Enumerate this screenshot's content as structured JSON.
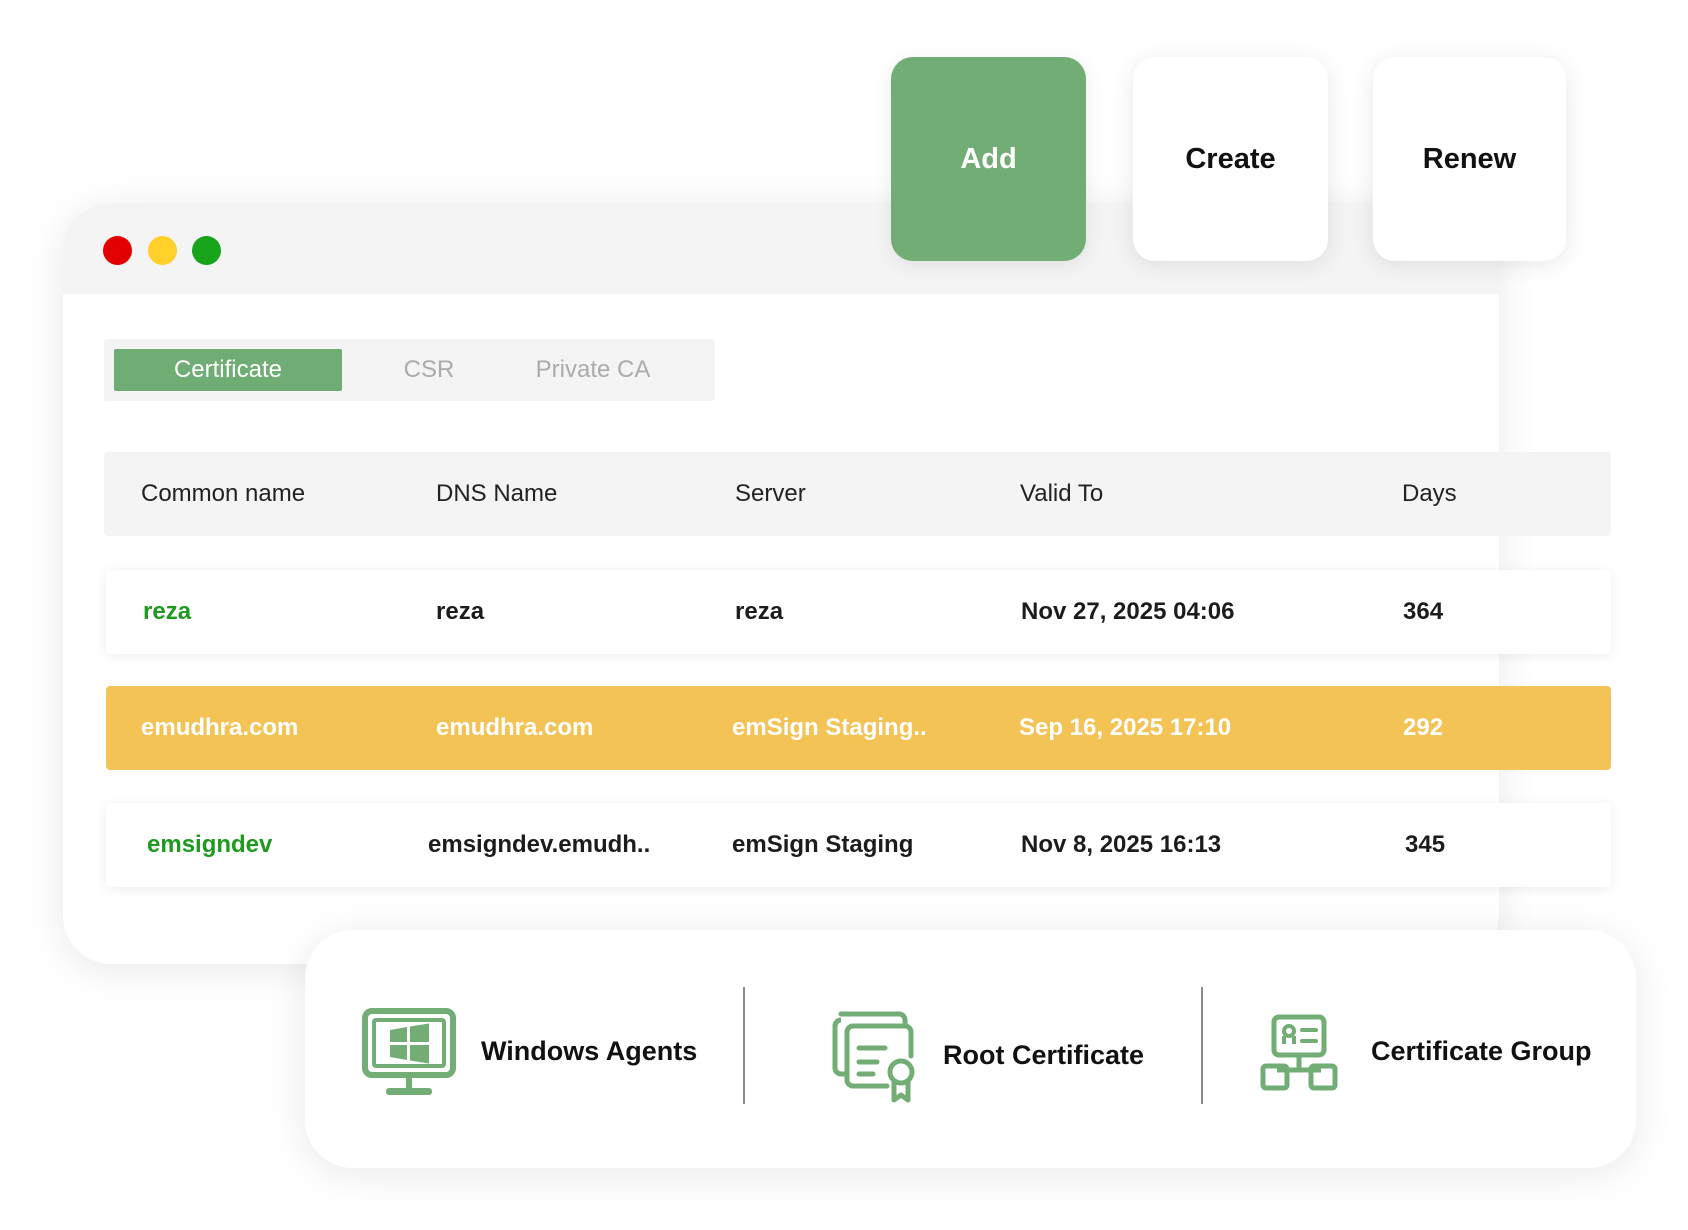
{
  "window": {
    "controls": [
      "close",
      "minimize",
      "maximize"
    ]
  },
  "tabs": [
    {
      "label": "Certificate",
      "active": true
    },
    {
      "label": "CSR",
      "active": false
    },
    {
      "label": "Private CA",
      "active": false
    }
  ],
  "table": {
    "columns": [
      "Common name",
      "DNS Name",
      "Server",
      "Valid To",
      "Days"
    ],
    "rows": [
      {
        "common_name": "reza",
        "dns_name": "reza",
        "server": "reza",
        "valid_to": "Nov 27, 2025 04:06",
        "days": "364",
        "highlighted": false
      },
      {
        "common_name": "emudhra.com",
        "dns_name": "emudhra.com",
        "server": "emSign Staging..",
        "valid_to": "Sep 16, 2025 17:10",
        "days": "292",
        "highlighted": true
      },
      {
        "common_name": "emsigndev",
        "dns_name": "emsigndev.emudh..",
        "server": "emSign Staging",
        "valid_to": "Nov 8, 2025 16:13",
        "days": "345",
        "highlighted": false
      }
    ]
  },
  "actions": {
    "add": "Add",
    "create": "Create",
    "renew": "Renew"
  },
  "features": [
    {
      "label": "Windows Agents",
      "icon": "monitor-windows-icon"
    },
    {
      "label": "Root Certificate",
      "icon": "certificate-ribbon-icon"
    },
    {
      "label": "Certificate Group",
      "icon": "certificate-group-icon"
    }
  ],
  "colors": {
    "accent_green": "#71ad74",
    "highlight_row": "#f4c355",
    "name_green": "#1e9a1e",
    "close": "#e30000",
    "minimize": "#ffd02a",
    "maximize": "#19a51b"
  }
}
